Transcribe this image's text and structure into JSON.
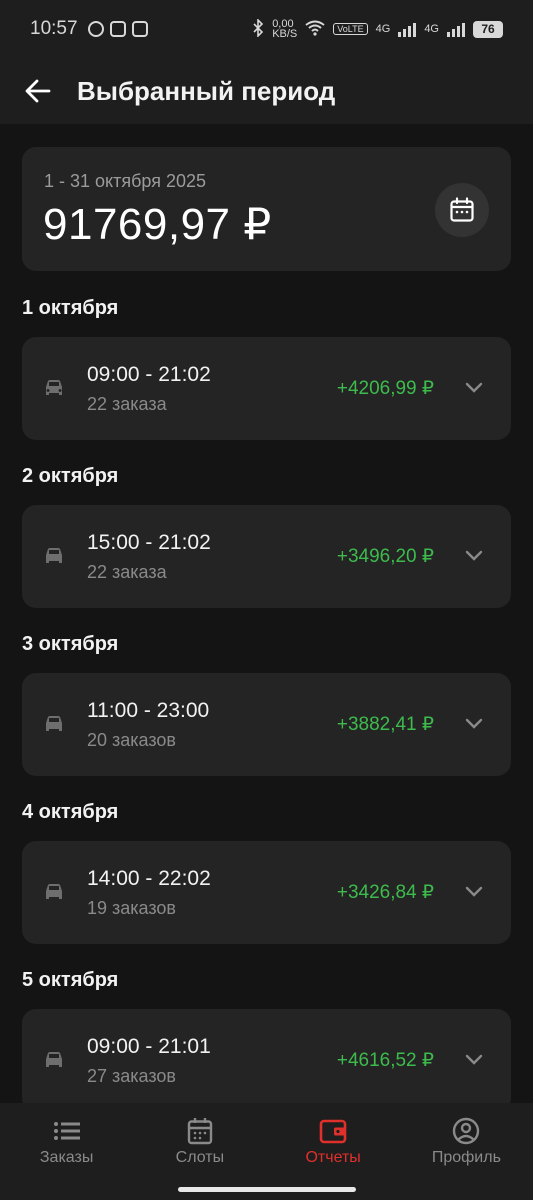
{
  "status_bar": {
    "time": "10:57",
    "net_speed_top": "0,00",
    "net_speed_bottom": "KB/S",
    "volte": "VoLTE",
    "lte1": "4G",
    "lte2": "4G",
    "battery": "76"
  },
  "header": {
    "title": "Выбранный период"
  },
  "summary": {
    "period": "1 - 31 октября 2025",
    "total": "91769,97 ₽"
  },
  "days": [
    {
      "date": "1 октября",
      "time": "09:00 - 21:02",
      "orders": "22 заказа",
      "amount": "+4206,99 ₽"
    },
    {
      "date": "2 октября",
      "time": "15:00 - 21:02",
      "orders": "22 заказа",
      "amount": "+3496,20 ₽"
    },
    {
      "date": "3 октября",
      "time": "11:00 - 23:00",
      "orders": "20 заказов",
      "amount": "+3882,41 ₽"
    },
    {
      "date": "4 октября",
      "time": "14:00 - 22:02",
      "orders": "19 заказов",
      "amount": "+3426,84 ₽"
    },
    {
      "date": "5 октября",
      "time": "09:00 - 21:01",
      "orders": "27 заказов",
      "amount": "+4616,52 ₽"
    }
  ],
  "nav": {
    "items": [
      {
        "label": "Заказы",
        "icon": "list-icon"
      },
      {
        "label": "Слоты",
        "icon": "calendar-icon"
      },
      {
        "label": "Отчеты",
        "icon": "wallet-icon"
      },
      {
        "label": "Профиль",
        "icon": "profile-icon"
      }
    ],
    "active_color": "#e0302b"
  },
  "colors": {
    "background": "#141414",
    "card": "#242424",
    "positive": "#3dbb4d"
  }
}
